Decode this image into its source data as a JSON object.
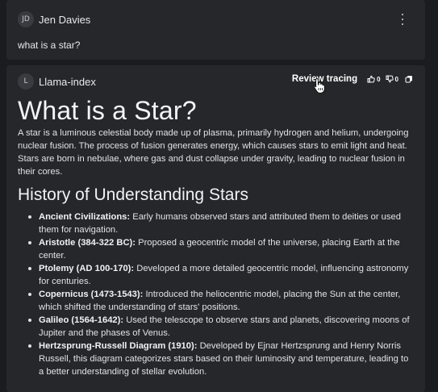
{
  "user_message": {
    "avatar_initials": "JD",
    "author": "Jen Davies",
    "text": "what is a star?"
  },
  "bot_message": {
    "avatar_initials": "L",
    "author": "Llama-index",
    "actions": {
      "review_label": "Review tracing",
      "thumbs_up_count": "0",
      "thumbs_down_count": "0",
      "icons": [
        "thumbs-up-icon",
        "thumbs-down-icon",
        "copy-icon"
      ]
    },
    "title": "What is a Star?",
    "intro": "A star is a luminous celestial body made up of plasma, primarily hydrogen and helium, undergoing nuclear fusion. The process of fusion generates energy, which causes stars to emit light and heat. Stars are born in nebulae, where gas and dust collapse under gravity, leading to nuclear fusion in their cores.",
    "section_heading": "History of Understanding Stars",
    "history": [
      {
        "term": "Ancient Civilizations:",
        "text": " Early humans observed stars and attributed them to deities or used them for navigation."
      },
      {
        "term": "Aristotle (384-322 BC):",
        "text": " Proposed a geocentric model of the universe, placing Earth at the center."
      },
      {
        "term": "Ptolemy (AD 100-170):",
        "text": " Developed a more detailed geocentric model, influencing astronomy for centuries."
      },
      {
        "term": "Copernicus (1473-1543):",
        "text": " Introduced the heliocentric model, placing the Sun at the center, which shifted the understanding of stars' positions."
      },
      {
        "term": "Galileo (1564-1642):",
        "text": " Used the telescope to observe stars and planets, discovering moons of Jupiter and the phases of Venus."
      },
      {
        "term": "Hertzsprung-Russell Diagram (1910):",
        "text": " Developed by Ejnar Hertzsprung and Henry Norris Russell, this diagram categorizes stars based on their luminosity and temperature, leading to a better understanding of stellar evolution."
      }
    ]
  },
  "colors": {
    "background": "#1b1c1f",
    "card": "#26272b",
    "text": "#e2e2e5"
  }
}
